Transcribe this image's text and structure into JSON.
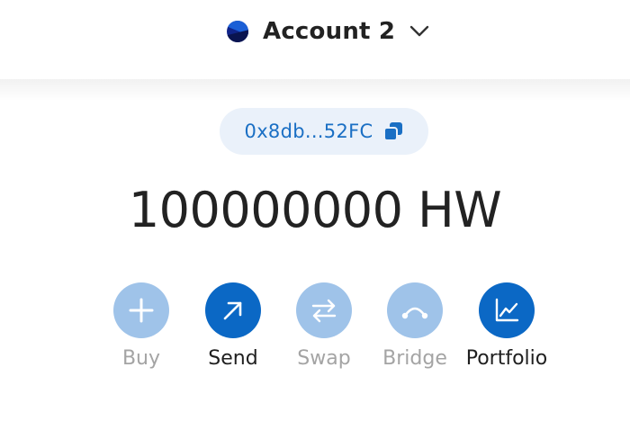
{
  "header": {
    "account_name": "Account 2"
  },
  "address": {
    "short": "0x8db...52FC"
  },
  "balance": {
    "text": "100000000 HW"
  },
  "actions": [
    {
      "label": "Buy",
      "icon": "plus-icon",
      "enabled": false
    },
    {
      "label": "Send",
      "icon": "arrow-up-right-icon",
      "enabled": true
    },
    {
      "label": "Swap",
      "icon": "swap-arrows-icon",
      "enabled": false
    },
    {
      "label": "Bridge",
      "icon": "bridge-arc-icon",
      "enabled": false
    },
    {
      "label": "Portfolio",
      "icon": "chart-line-icon",
      "enabled": true
    }
  ],
  "colors": {
    "accent": "#0b68c5",
    "accent_disabled": "#9fc3e9",
    "address_text": "#1a6fc4",
    "address_bg": "#eaf1fa"
  }
}
